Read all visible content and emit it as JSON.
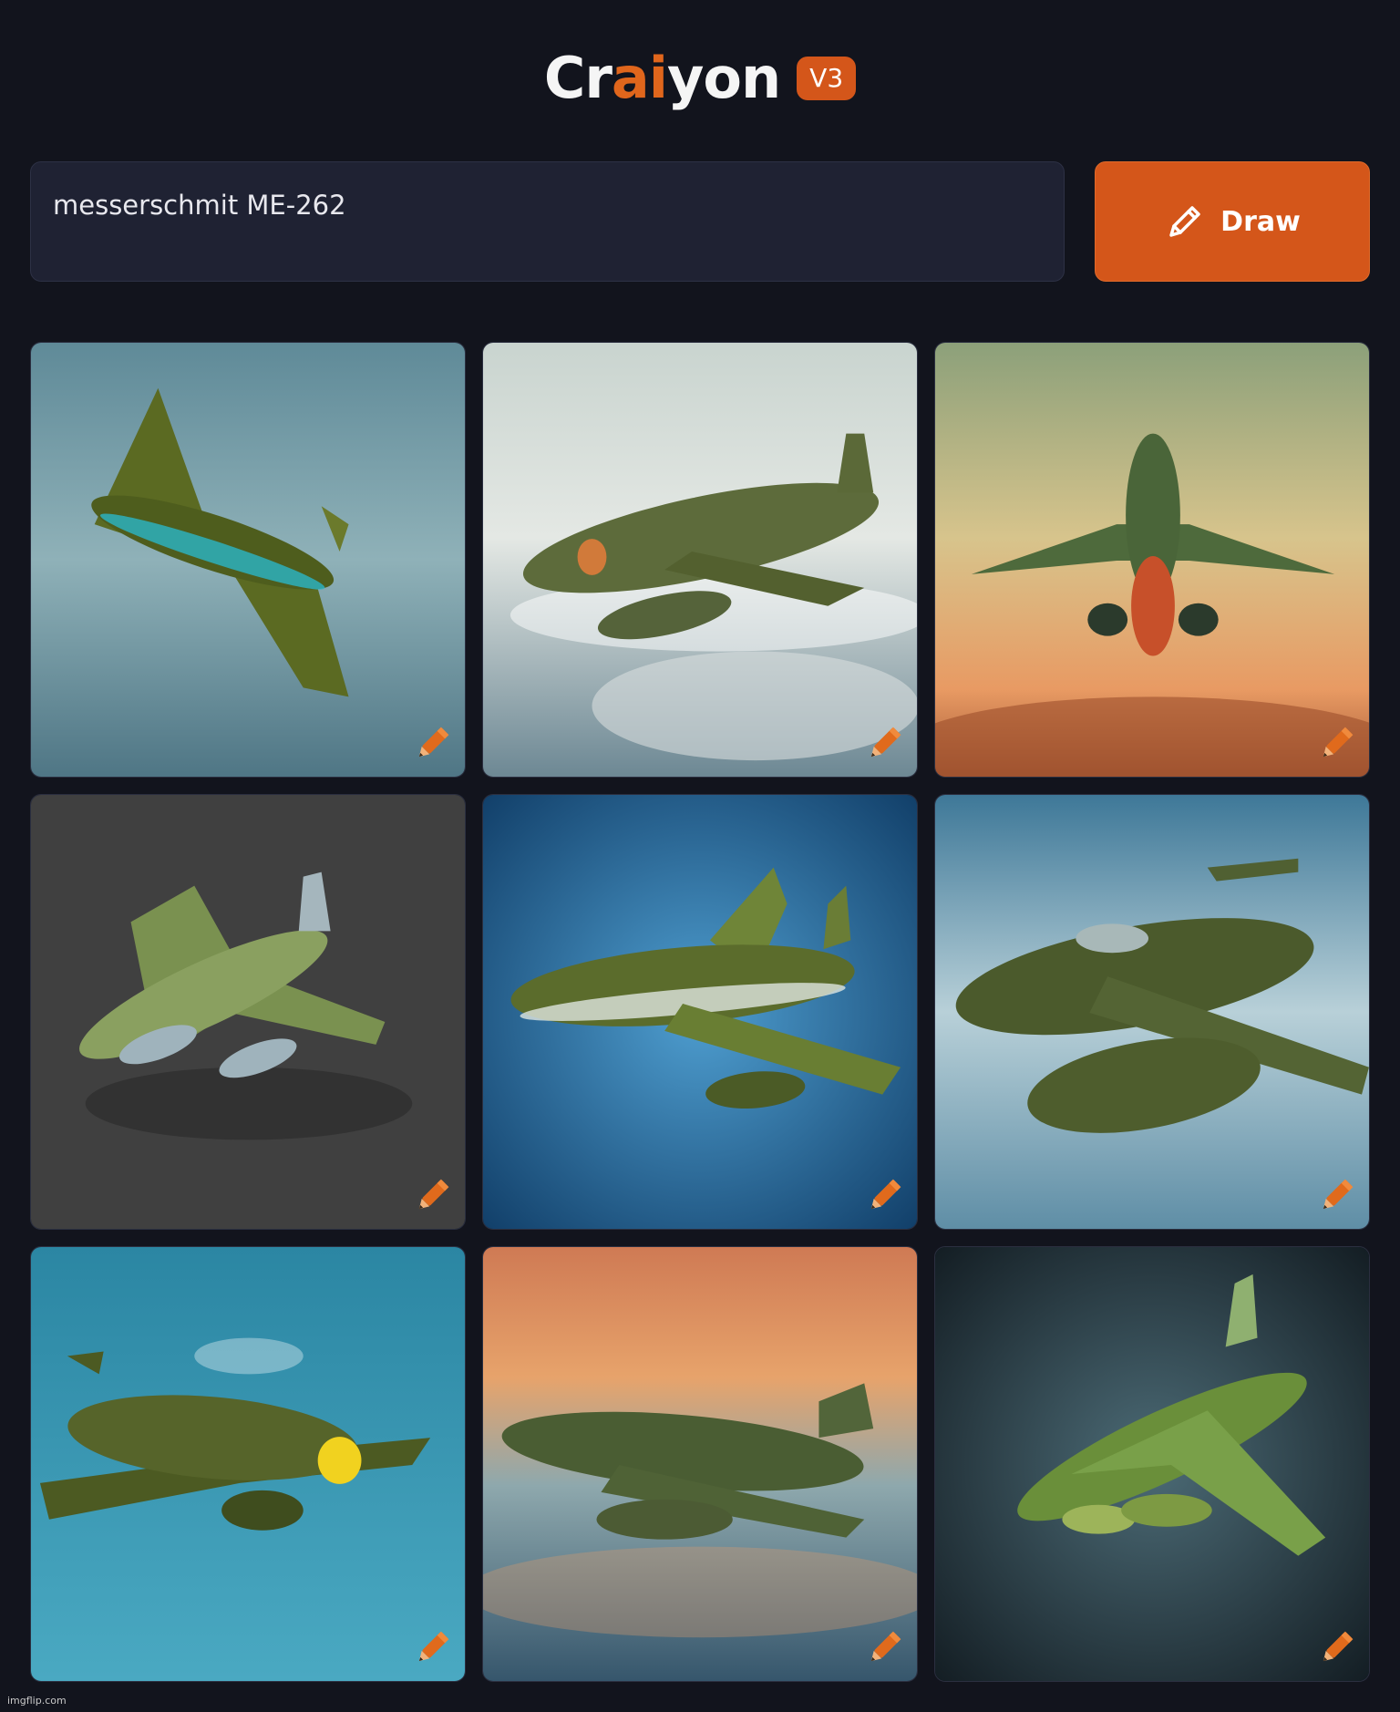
{
  "header": {
    "logo_prefix": "Cr",
    "logo_accent": "ai",
    "logo_suffix": "yon",
    "version": "V3"
  },
  "prompt": {
    "value": "messerschmit ME-262"
  },
  "draw_button": {
    "label": "Draw",
    "icon": "pencil-icon"
  },
  "results": {
    "count": 9,
    "edit_icon": "pencil-edit-icon"
  },
  "colors": {
    "background": "#12141d",
    "accent": "#d4561a",
    "input_bg": "#1f2233"
  },
  "watermark": "imgflip.com"
}
